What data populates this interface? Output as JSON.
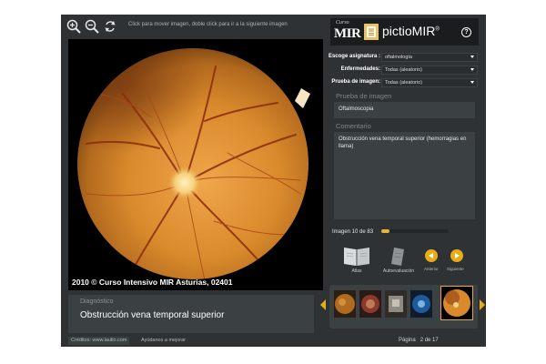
{
  "toolbar": {
    "zoom_in_icon": "zoom-in-icon",
    "zoom_out_icon": "zoom-out-icon",
    "rotate_icon": "rotate-icon",
    "hint": "Click para mover imagen, doble click para ir a la siguiente imagen"
  },
  "viewer": {
    "copyright": "2010 © Curso Intensivo MIR Asturias, 02401"
  },
  "diagnosis": {
    "label": "Diagnóstico",
    "text": "Obstrucción vena temporal superior"
  },
  "footer": {
    "credits": "Créditos: www.laullo.com",
    "help": "Ayúdanos a mejorar",
    "page_label": "Página",
    "page_value": "2 de 17"
  },
  "header": {
    "curso": "Curso",
    "mir": "MIR",
    "app_name": "pictioMIR",
    "registered": "®",
    "help": "?"
  },
  "filters": [
    {
      "label": "Escoge asignatura :",
      "value": "oftalmología"
    },
    {
      "label": "Enfermedades:",
      "value": "Todas (aleatorio)"
    },
    {
      "label": "Prueba de imagen:",
      "value": "Todas (aleatorio)"
    }
  ],
  "panels": {
    "test_label": "Prueba de imagen",
    "test_value": "Oftalmoscopia",
    "comment_label": "Comentario",
    "comment_value": "Obstrucción vena temporal superior (hemorragias en llama)"
  },
  "progress": {
    "counter": "Imagen 10 de 83",
    "fraction": 0.12
  },
  "actions": {
    "atlas": "Atlas",
    "self_eval": "Autoevaluación",
    "prev": "Anterior",
    "next": "Siguiente"
  },
  "colors": {
    "accent": "#e8ac1a",
    "background": "#2e3235",
    "panel": "#3b4043"
  }
}
